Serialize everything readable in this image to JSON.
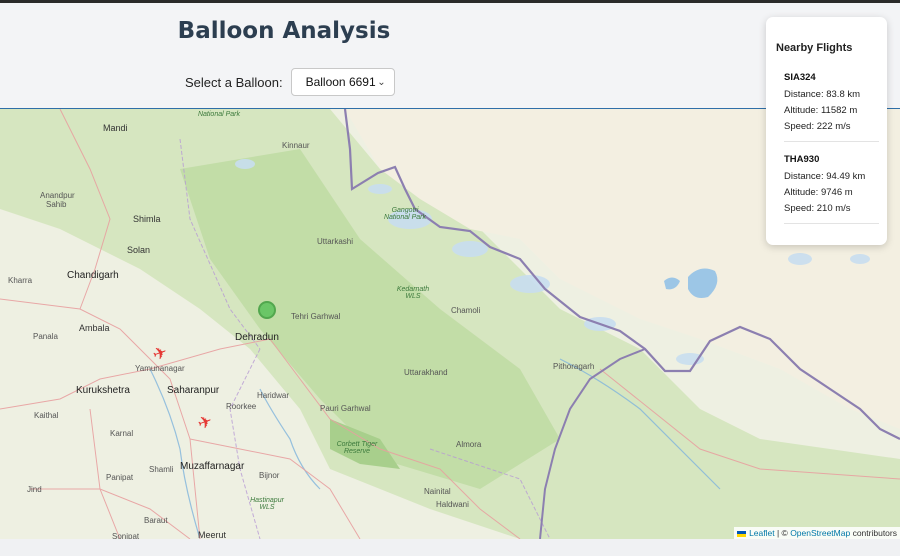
{
  "page": {
    "title": "Balloon Analysis"
  },
  "selector": {
    "label": "Select a Balloon:",
    "selected": "Balloon 6691"
  },
  "flights_panel": {
    "title": "Nearby Flights",
    "flights": [
      {
        "id": "SIA324",
        "distance": "Distance: 83.8 km",
        "altitude": "Altitude: 11582 m",
        "speed": "Speed: 222 m/s"
      },
      {
        "id": "THA930",
        "distance": "Distance: 94.49 km",
        "altitude": "Altitude: 9746 m",
        "speed": "Speed: 210 m/s"
      }
    ]
  },
  "map": {
    "labels": {
      "mandi": "Mandi",
      "anandpur": "Anandpur",
      "sahib": "Sahib",
      "shimla": "Shimla",
      "solan": "Solan",
      "chandigarh": "Chandigarh",
      "kharra": "Kharra",
      "ambala": "Ambala",
      "panala": "Panala",
      "yamunanagar": "Yamunanagar",
      "kurukshetra": "Kurukshetra",
      "saharanpur": "Saharanpur",
      "roorkee": "Roorkee",
      "kaithal": "Kaithal",
      "karnal": "Karnal",
      "shamli": "Shamli",
      "muzaffarnagar": "Muzaffarnagar",
      "panipat": "Panipat",
      "baraut": "Baraut",
      "meerut": "Meerut",
      "sonipat": "Sonipat",
      "jind": "Jind",
      "dehradun": "Dehradun",
      "tehri": "Tehri Garhwal",
      "haridwar": "Haridwar",
      "pauri": "Pauri Garhwal",
      "bijnor": "Bijnor",
      "uttarkashi": "Uttarkashi",
      "chamoli": "Chamoli",
      "uttarakhand": "Uttarakhand",
      "almora": "Almora",
      "nainital": "Nainital",
      "haldwani": "Haldwani",
      "pithoragarh": "Pithoragarh",
      "kinnaur": "Kinnaur",
      "gangotri": "Gangotri National Park",
      "kedarnath": "Kedarnath WLS",
      "corbett": "Corbett Tiger Reserve",
      "hastinapur": "Hastinapur WLS",
      "national_park": "National Park"
    },
    "markers": {
      "balloon": "balloon-marker",
      "planes": [
        "plane-icon",
        "plane-icon"
      ]
    },
    "attribution": {
      "leaflet": "Leaflet",
      "sep": "| ©",
      "osm": "OpenStreetMap",
      "contributors": "contributors"
    }
  }
}
